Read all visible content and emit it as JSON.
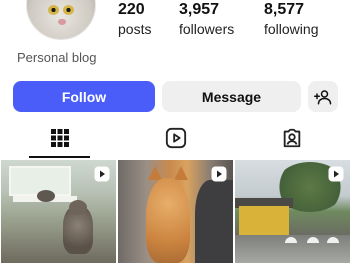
{
  "profile": {
    "bio": "Personal blog",
    "avatar_icon": "cat-avatar"
  },
  "stats": [
    {
      "value": "220",
      "label": "posts"
    },
    {
      "value": "3,957",
      "label": "followers"
    },
    {
      "value": "8,577",
      "label": "following"
    }
  ],
  "actions": {
    "follow_label": "Follow",
    "message_label": "Message",
    "add_user_icon": "add-person-icon",
    "follow_color": "#4a5df9"
  },
  "tabs": [
    {
      "icon": "grid-icon",
      "active": true
    },
    {
      "icon": "reels-icon",
      "active": false
    },
    {
      "icon": "tagged-icon",
      "active": false
    }
  ],
  "grid": [
    {
      "type": "reel",
      "subject": "cat by window"
    },
    {
      "type": "reel",
      "subject": "orange cat"
    },
    {
      "type": "reel",
      "subject": "temple in rain"
    }
  ]
}
